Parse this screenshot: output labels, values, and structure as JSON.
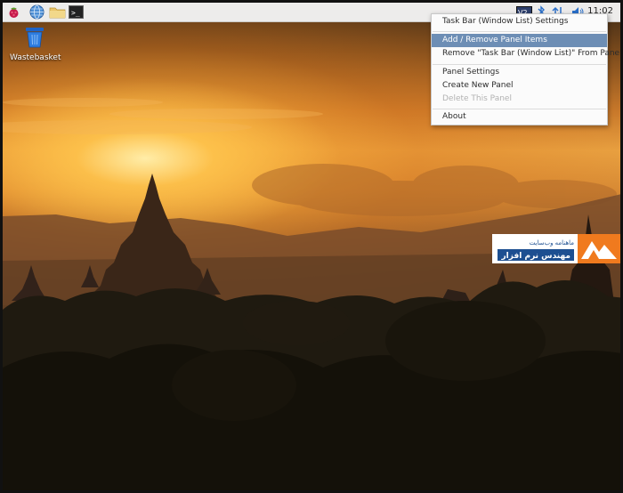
{
  "taskbar": {
    "clock": "11:02",
    "launchers": [
      "raspberry-menu-icon",
      "web-browser-icon",
      "file-manager-icon",
      "terminal-icon"
    ],
    "tray": [
      "vnc-icon",
      "bluetooth-icon",
      "network-icon",
      "volume-icon"
    ]
  },
  "desktop": {
    "trash_label": "Wastebasket"
  },
  "context_menu": {
    "items": [
      "Task Bar (Window List) Settings",
      "Add / Remove Panel Items",
      "Remove \"Task Bar (Window List)\" From Panel",
      "Panel Settings",
      "Create New Panel",
      "Delete This Panel",
      "About"
    ],
    "highlighted_index": 1,
    "disabled_index": 5,
    "highlight_color": "#6d8eb5"
  },
  "watermark": {
    "text_top": "ماهنامه وب‌سایت",
    "text_main": "مهندس نرم افزار",
    "brand_color": "#f07a1e",
    "brand_blue": "#1d4f91"
  }
}
